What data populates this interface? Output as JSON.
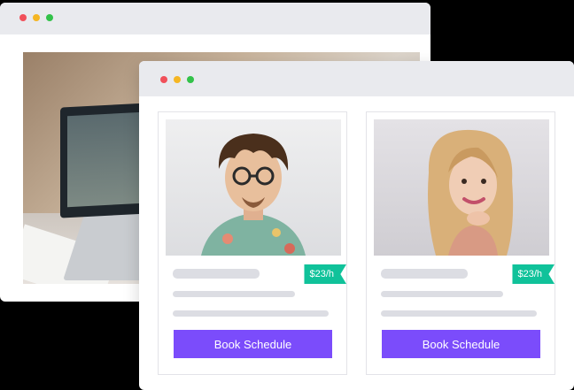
{
  "colors": {
    "red": "#f1505a",
    "yellow": "#f5b623",
    "green": "#33c24a",
    "accent_purple": "#7b4cfb",
    "accent_green": "#10c29a"
  },
  "cards": [
    {
      "price": "$23/h",
      "button_label": "Book Schedule",
      "photo": "tutor-man-photo"
    },
    {
      "price": "$23/h",
      "button_label": "Book Schedule",
      "photo": "tutor-woman-photo"
    }
  ]
}
